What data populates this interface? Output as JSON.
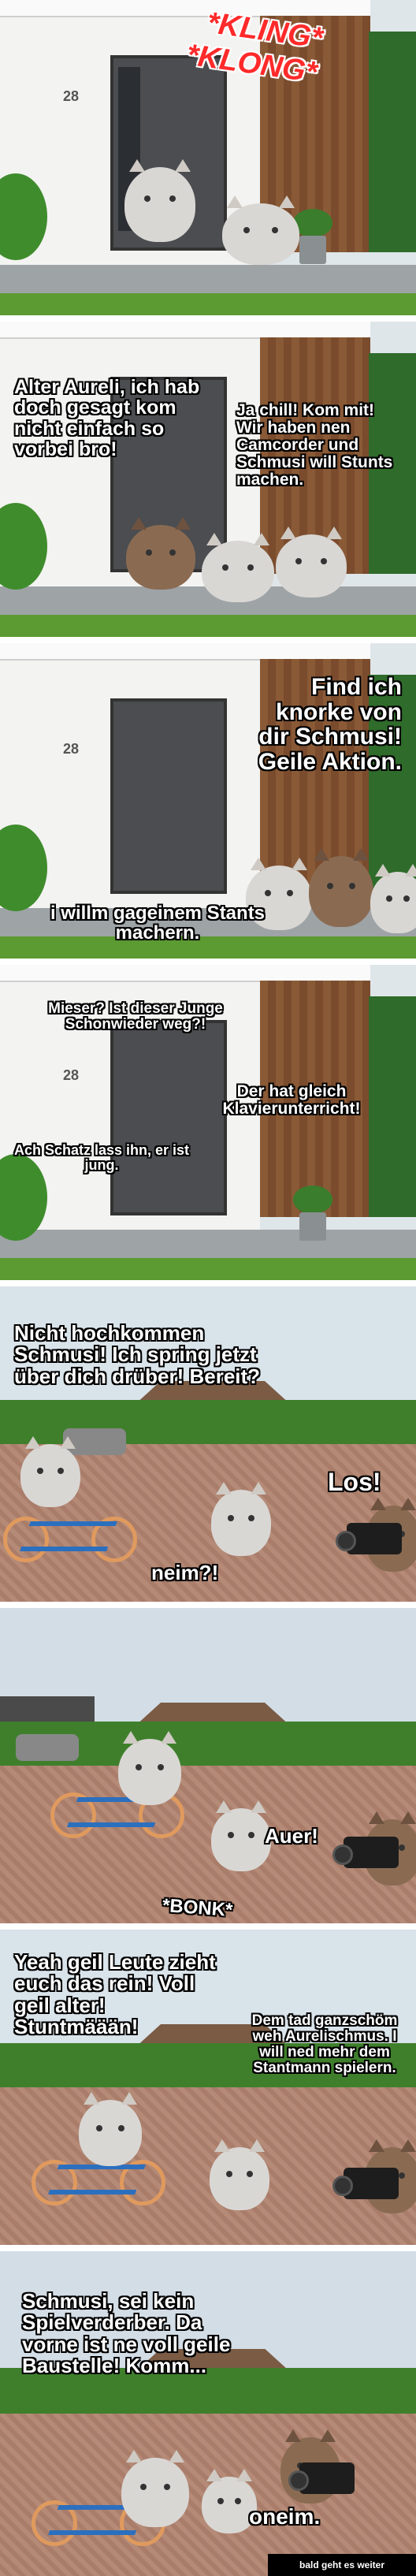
{
  "panel1": {
    "house_number": "28",
    "sound": [
      "*KLING*",
      "*KLONG*"
    ]
  },
  "panel2": {
    "speech_left": "Alter Aureli, ich hab doch gesagt kom nicht einfach so vorbei bro!",
    "speech_right": "Ja chill! Kom mit! Wir haben nen Camcorder und Schmusi will Stunts machen."
  },
  "panel3": {
    "house_number": "28",
    "speech_top": "Find ich knorke von dir Schmusi! Geile Aktion.",
    "speech_bottom": "i willm gageinem Stants machern."
  },
  "panel4": {
    "house_number": "28",
    "speech_top": "Mieser? Ist dieser Junge Schonwieder weg?!",
    "speech_mid": "Der hat gleich Klavierunterricht!",
    "speech_bottom": "Ach Schatz lass ihn, er ist jung."
  },
  "panel5": {
    "speech_top": "Nicht hochkommen Schmusi! Ich spring jetzt über dich drüber! Bereit?",
    "speech_right": "Los!",
    "speech_bottom": "neim?!"
  },
  "panel6": {
    "speech_right": "Auer!",
    "sound": "*BONK*"
  },
  "panel7": {
    "speech_left": "Yeah geil Leute zieht euch das rein! Voll geil alter! Stuntmäään!",
    "speech_right": "Dem tad ganzschöm weh Aurelischmus. I will ned mehr dem Stantmann spielern."
  },
  "panel8": {
    "speech_left": "Schmusi, sei kein Spielverderber. Da vorne ist ne voll geile Baustelle! Komm...",
    "speech_bottom": "oneim."
  },
  "footer": {
    "label": "bald geht es weiter"
  }
}
